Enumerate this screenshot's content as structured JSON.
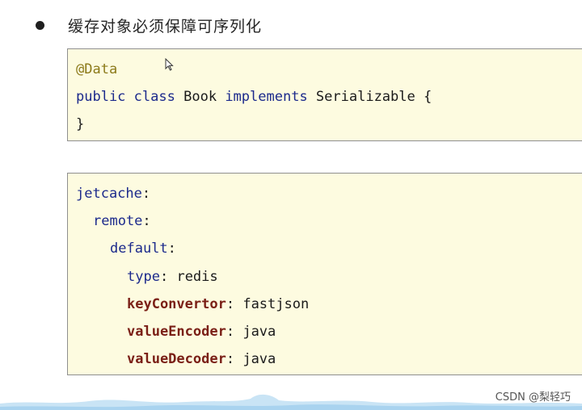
{
  "bullet": {
    "text": "缓存对象必须保障可序列化"
  },
  "java_code": {
    "annotation": "@Data",
    "kw_public": "public",
    "kw_class": "class",
    "class_name": "Book",
    "kw_implements": "implements",
    "interface": "Serializable",
    "open_brace": "{",
    "close_brace": "}"
  },
  "yaml_code": {
    "root_key": "jetcache",
    "remote_key": "remote",
    "default_key": "default",
    "type_key": "type",
    "type_value": "redis",
    "key_convertor_key": "keyConvertor",
    "key_convertor_value": "fastjson",
    "value_encoder_key": "valueEncoder",
    "value_encoder_value": "java",
    "value_decoder_key": "valueDecoder",
    "value_decoder_value": "java",
    "colon": ":"
  },
  "watermark": {
    "text": "CSDN @梨轻巧"
  },
  "colors": {
    "code_background": "#fdfbe0",
    "keyword": "#1c2a8c",
    "annotation": "#8c7a1a",
    "highlight_key": "#7a1f16"
  },
  "icons": {
    "bullet": "bullet-dot-icon",
    "cursor": "mouse-pointer-icon"
  }
}
